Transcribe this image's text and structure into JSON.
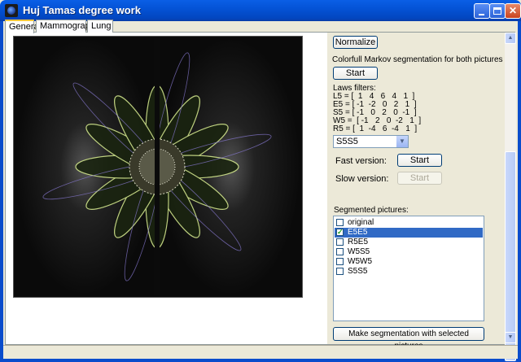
{
  "window": {
    "title": "Huj Tamas degree work"
  },
  "tabs": [
    {
      "label": "General",
      "active": true
    },
    {
      "label": "Mammography",
      "active": false
    },
    {
      "label": "Lung",
      "active": false
    }
  ],
  "controls": {
    "normalize_label": "Normalize",
    "markov_text": "Colorfull Markov segmentation for both pictures",
    "markov_start_label": "Start",
    "laws_title": "Laws filters:",
    "laws_lines": [
      "L5 = [  1   4   6   4   1  ]",
      "E5 = [ -1  -2   0   2   1  ]",
      "S5 = [ -1   0   2   0  -1  ]",
      "W5 =  [ -1   2   0  -2   1  ]",
      "R5 = [  1  -4   6  -4   1  ]"
    ],
    "filter_select_value": "S5S5",
    "fast_label": "Fast version:",
    "fast_start_label": "Start",
    "slow_label": "Slow version:",
    "slow_start_label": "Start",
    "segmented_title": "Segmented pictures:",
    "make_segmentation_label": "Make segmentation with selected pictures"
  },
  "segmented_list": [
    {
      "label": "original",
      "checked": false,
      "selected": false
    },
    {
      "label": "E5E5",
      "checked": true,
      "selected": true
    },
    {
      "label": "R5E5",
      "checked": false,
      "selected": false
    },
    {
      "label": "W5S5",
      "checked": false,
      "selected": false
    },
    {
      "label": "W5W5",
      "checked": false,
      "selected": false
    },
    {
      "label": "S5S5",
      "checked": false,
      "selected": false
    }
  ],
  "icons": {
    "app": "app-icon",
    "minimize": "minimize-icon",
    "maximize": "maximize-icon",
    "close": "close-icon",
    "dropdown": "chevron-down-icon"
  },
  "colors": {
    "title_bar": "#0453d6",
    "selection": "#316ac5",
    "accent_tab": "#ffc83c"
  }
}
